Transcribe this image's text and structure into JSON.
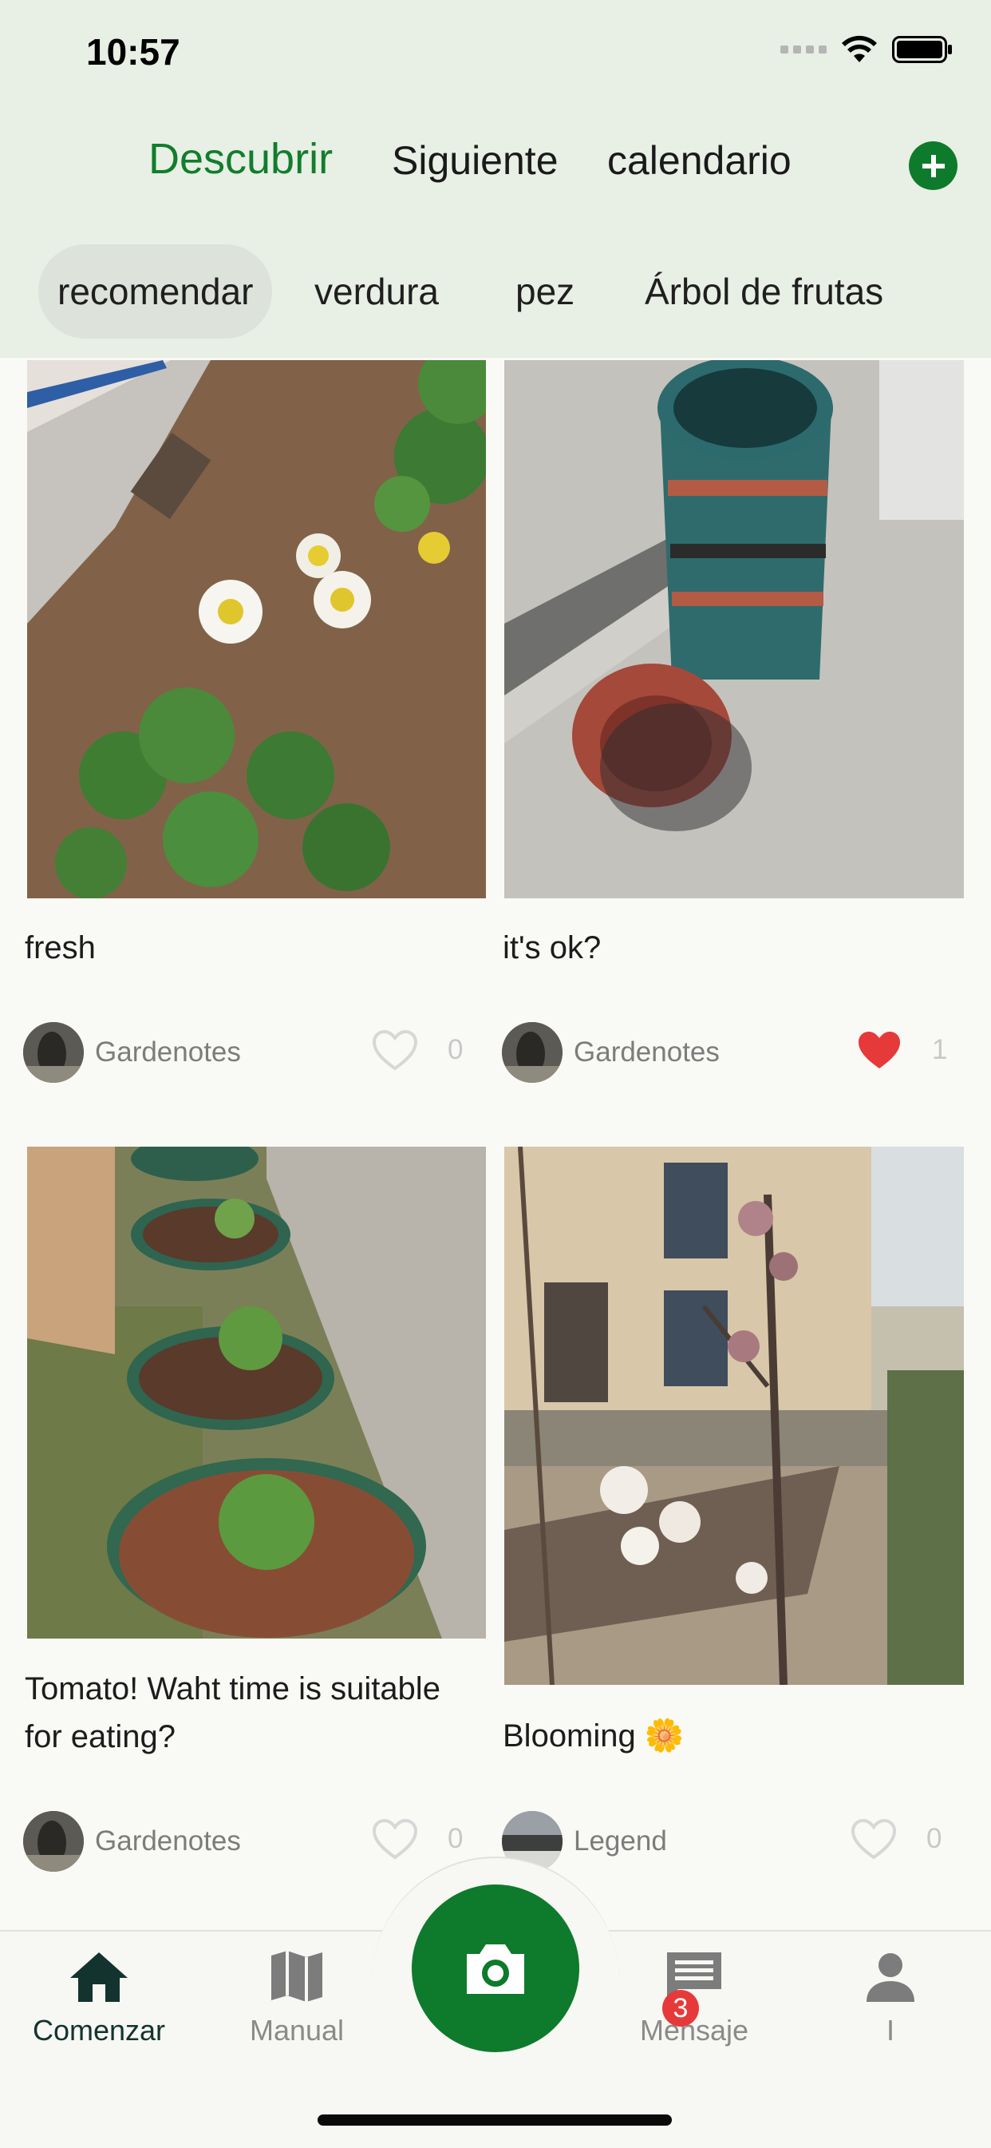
{
  "status": {
    "time": "10:57"
  },
  "topnav": {
    "tabs": [
      "Descubrir",
      "Siguiente",
      "calendario"
    ]
  },
  "categories": [
    "recomendar",
    "verdura",
    "pez",
    "Árbol de frutas"
  ],
  "posts": [
    {
      "title": "fresh",
      "author": "Gardenotes",
      "likes": "0",
      "liked": false
    },
    {
      "title": "it's ok?",
      "author": "Gardenotes",
      "likes": "1",
      "liked": true
    },
    {
      "title": "Tomato! Waht time is suitable for eating?",
      "author": "Gardenotes",
      "likes": "0",
      "liked": false
    },
    {
      "title": "Blooming 🌼",
      "author": "Legend",
      "likes": "0",
      "liked": false
    }
  ],
  "tabbar": {
    "items": [
      "Comenzar",
      "Manual",
      "Mensaje",
      "I"
    ],
    "message_badge": "3"
  },
  "colors": {
    "accent": "#0e7a2c",
    "like_red": "#e6393a",
    "header_bg": "#e8efe4"
  }
}
